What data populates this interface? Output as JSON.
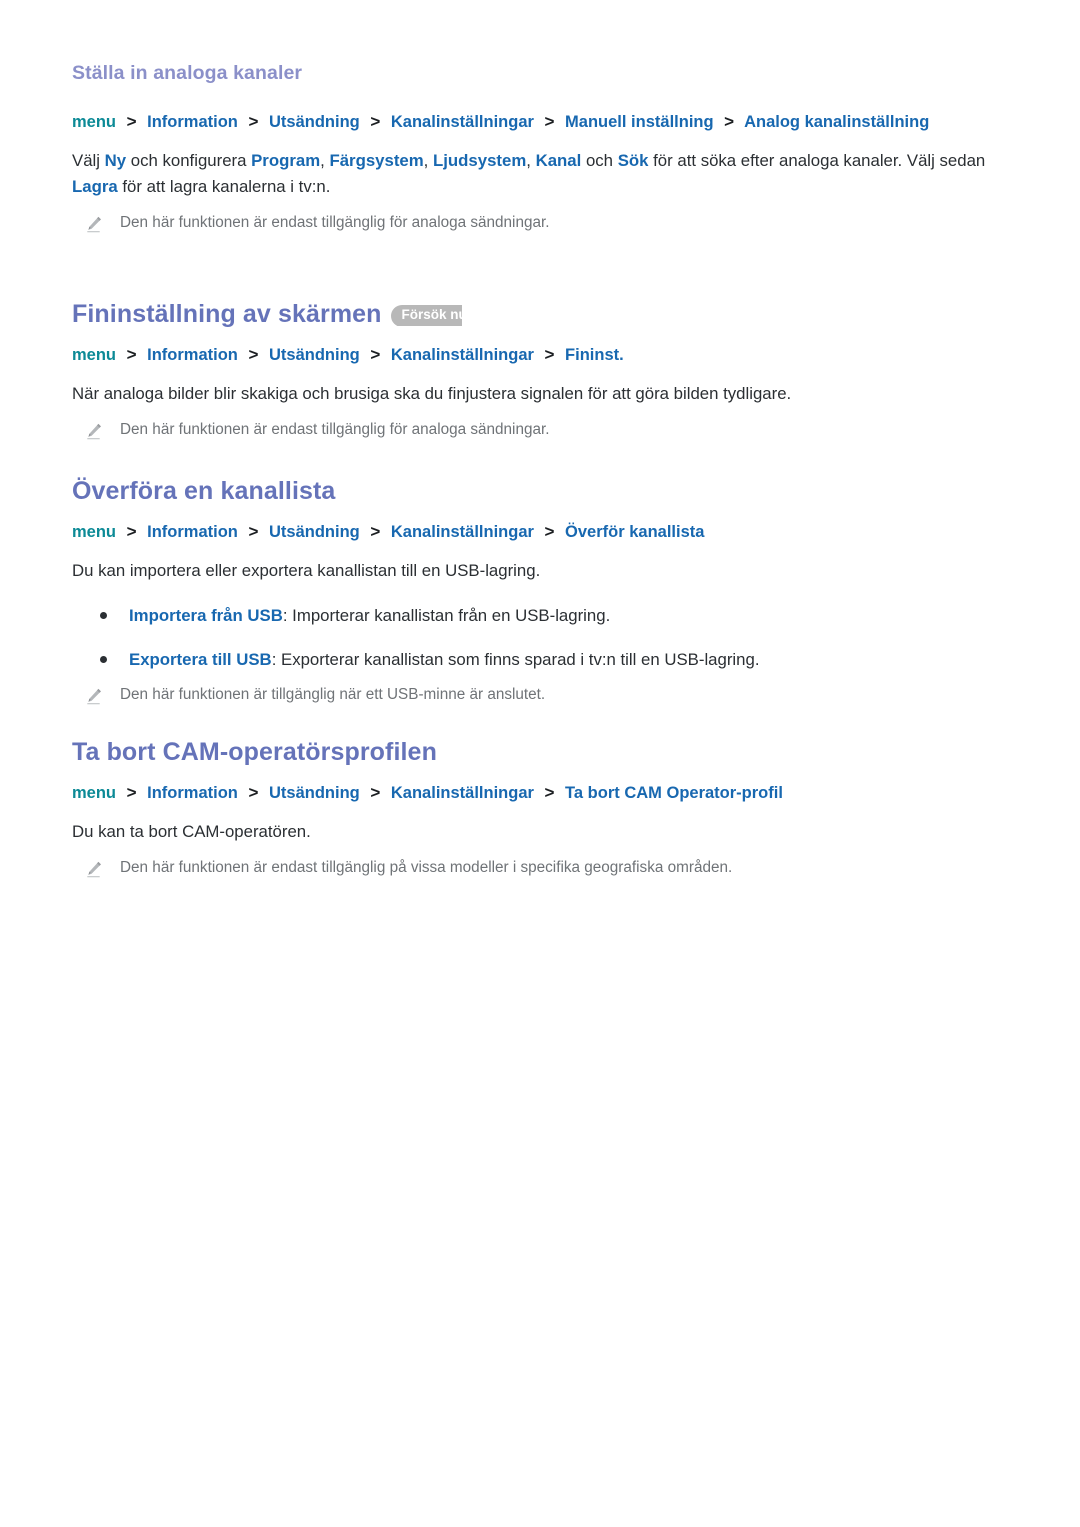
{
  "document": {
    "language": "sv",
    "background_color": "#ffffff",
    "colors": {
      "heading_sub": "#8b90c9",
      "heading_main": "#6573b9",
      "breadcrumb_menu": "#0c8a96",
      "breadcrumb_item": "#1868b0",
      "keyword": "#1868b0",
      "body_text": "#2b2f33",
      "note_text": "#6f7377",
      "badge_bg": "#b8b8b8",
      "badge_text": "#ffffff"
    },
    "icons": {
      "pencil": "pencil-icon",
      "chevron": "chevron-right-icon",
      "bullet": "bullet-dot-icon"
    }
  },
  "sections": [
    {
      "id": "stalla-in-analoga-kanaler",
      "level": 3,
      "title": "Ställa in analoga kanaler",
      "breadcrumb": [
        "menu",
        "Information",
        "Utsändning",
        "Kanalinställningar",
        "Manuell inställning",
        "Analog kanalinställning"
      ],
      "separator": ">",
      "paragraph_parts": [
        {
          "t": "Välj ",
          "kw": false
        },
        {
          "t": "Ny",
          "kw": true
        },
        {
          "t": " och konfigurera ",
          "kw": false
        },
        {
          "t": "Program",
          "kw": true
        },
        {
          "t": ", ",
          "kw": false
        },
        {
          "t": "Färgsystem",
          "kw": true
        },
        {
          "t": ", ",
          "kw": false
        },
        {
          "t": "Ljudsystem",
          "kw": true
        },
        {
          "t": ", ",
          "kw": false
        },
        {
          "t": "Kanal",
          "kw": true
        },
        {
          "t": " och ",
          "kw": false
        },
        {
          "t": "Sök",
          "kw": true
        },
        {
          "t": " för att söka efter analoga kanaler. Välj sedan ",
          "kw": false
        },
        {
          "t": "Lagra",
          "kw": true
        },
        {
          "t": " för att lagra kanalerna i tv:n.",
          "kw": false
        }
      ],
      "notes": [
        "Den här funktionen är endast tillgänglig för analoga sändningar."
      ]
    },
    {
      "id": "fininstallning-av-skarmen",
      "level": 2,
      "title": "Fininställning av skärmen",
      "badge": "Försök nu",
      "breadcrumb": [
        "menu",
        "Information",
        "Utsändning",
        "Kanalinställningar",
        "Fininst."
      ],
      "separator": ">",
      "paragraph": "När analoga bilder blir skakiga och brusiga ska du finjustera signalen för att göra bilden tydligare.",
      "notes": [
        "Den här funktionen är endast tillgänglig för analoga sändningar."
      ]
    },
    {
      "id": "overfora-en-kanallista",
      "level": 2,
      "title": "Överföra en kanallista",
      "breadcrumb": [
        "menu",
        "Information",
        "Utsändning",
        "Kanalinställningar",
        "Överför kanallista"
      ],
      "separator": ">",
      "paragraph": "Du kan importera eller exportera kanallistan till en USB-lagring.",
      "bullets": [
        {
          "term": "Importera från USB",
          "rest": ": Importerar kanallistan från en USB-lagring."
        },
        {
          "term": "Exportera till USB",
          "rest": ": Exporterar kanallistan som finns sparad i tv:n till en USB-lagring."
        }
      ],
      "notes": [
        "Den här funktionen är tillgänglig när ett USB-minne är anslutet."
      ]
    },
    {
      "id": "ta-bort-cam-operatorsprofilen",
      "level": 2,
      "title": "Ta bort CAM-operatörsprofilen",
      "breadcrumb": [
        "menu",
        "Information",
        "Utsändning",
        "Kanalinställningar",
        "Ta bort CAM Operator-profil"
      ],
      "separator": ">",
      "paragraph": "Du kan ta bort CAM-operatören.",
      "notes": [
        "Den här funktionen är endast tillgänglig på vissa modeller i specifika geografiska områden."
      ]
    }
  ]
}
